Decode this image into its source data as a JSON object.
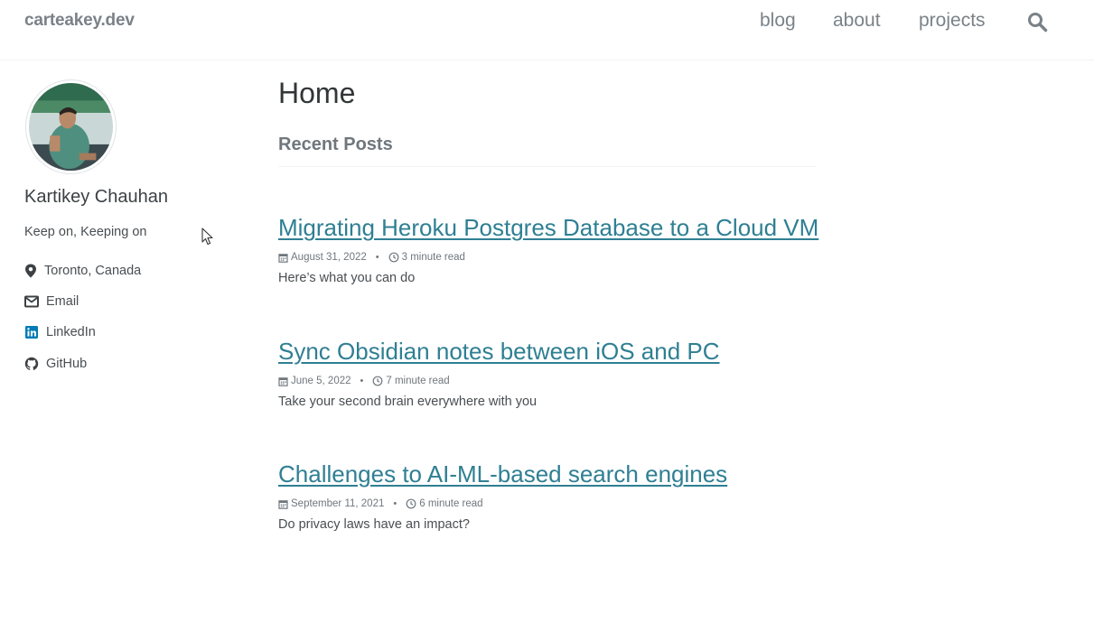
{
  "masthead": {
    "site_title": "carteakey.dev",
    "nav": [
      "blog",
      "about",
      "projects"
    ],
    "search_icon": "search-icon"
  },
  "sidebar": {
    "author_name": "Kartikey Chauhan",
    "bio": "Keep on, Keeping on",
    "links": [
      {
        "label": "Toronto, Canada",
        "icon": "location-pin-icon"
      },
      {
        "label": "Email",
        "icon": "envelope-icon"
      },
      {
        "label": "LinkedIn",
        "icon": "linkedin-icon"
      },
      {
        "label": "GitHub",
        "icon": "github-icon"
      }
    ]
  },
  "main": {
    "page_title": "Home",
    "subtitle": "Recent Posts",
    "posts": [
      {
        "title": "Migrating Heroku Postgres Database to a Cloud VM",
        "date": "August 31, 2022",
        "read_time": "3 minute read",
        "excerpt": "Here’s what you can do"
      },
      {
        "title": "Sync Obsidian notes between iOS and PC",
        "date": "June 5, 2022",
        "read_time": "7 minute read",
        "excerpt": "Take your second brain everywhere with you"
      },
      {
        "title": "Challenges to AI-ML-based search engines",
        "date": "September 11, 2021",
        "read_time": "6 minute read",
        "excerpt": "Do privacy laws have an impact?"
      }
    ]
  },
  "colors": {
    "link": "#2f7f93",
    "nav": "#7a8288",
    "text": "#494e52",
    "linkedin": "#007bb6"
  }
}
